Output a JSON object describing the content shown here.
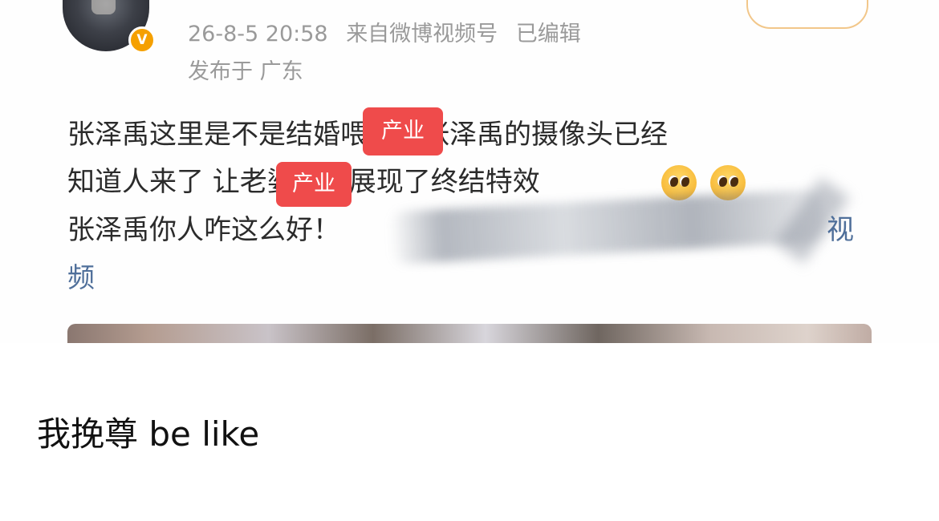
{
  "post": {
    "timestamp": "26-8-5 20:58",
    "source": "来自微博视频号",
    "edited": "已编辑",
    "location": "发布于 广东",
    "verified_badge": "V",
    "lines": [
      "张泽禹这里是不是结婚喂啊！张泽禹的摄像头已经",
      "知道人来了 让老婆打了展现了终结特效",
      "张泽禹你人咋这么好！",
      "频"
    ],
    "tags": [
      "产业",
      "产业"
    ],
    "more_link": "视",
    "emoji_icons": [
      "pleading-face-icon",
      "pleading-face-icon"
    ]
  },
  "caption": "我挽尊 be like",
  "colors": {
    "meta_text": "#9a9a9a",
    "body_text": "#2b2b2b",
    "link": "#4f6f9a",
    "tag": "#ef4b4b",
    "badge": "#f5a000"
  }
}
